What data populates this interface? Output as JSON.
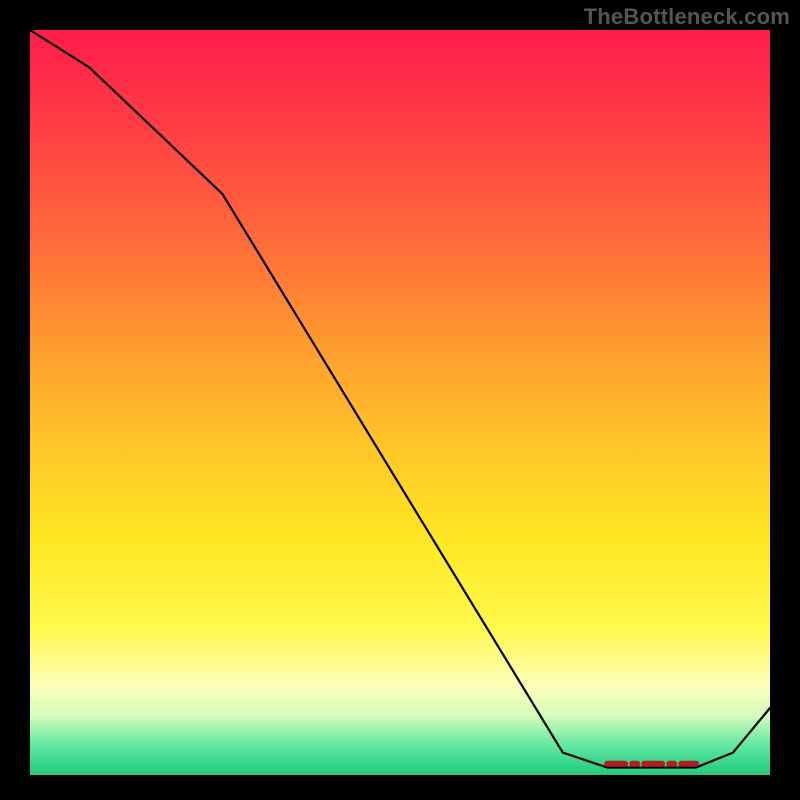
{
  "watermark": "TheBottleneck.com",
  "colors": {
    "background": "#000000",
    "curve": "#000000",
    "floor_segment": "#b02020",
    "gradient_top": "#ff1d4b",
    "gradient_bottom": "#28c97f"
  },
  "chart_data": {
    "type": "line",
    "title": "",
    "xlabel": "",
    "ylabel": "",
    "xlim": [
      0,
      100
    ],
    "ylim": [
      0,
      100
    ],
    "grid": false,
    "legend": false,
    "series": [
      {
        "name": "curve",
        "x": [
          0,
          8,
          26,
          72,
          78,
          90,
          95,
          100
        ],
        "values": [
          100,
          95,
          78,
          3,
          1,
          1,
          3,
          9
        ]
      }
    ],
    "floor_segment": {
      "x_start": 78,
      "x_end": 90,
      "y": 1.5
    }
  }
}
